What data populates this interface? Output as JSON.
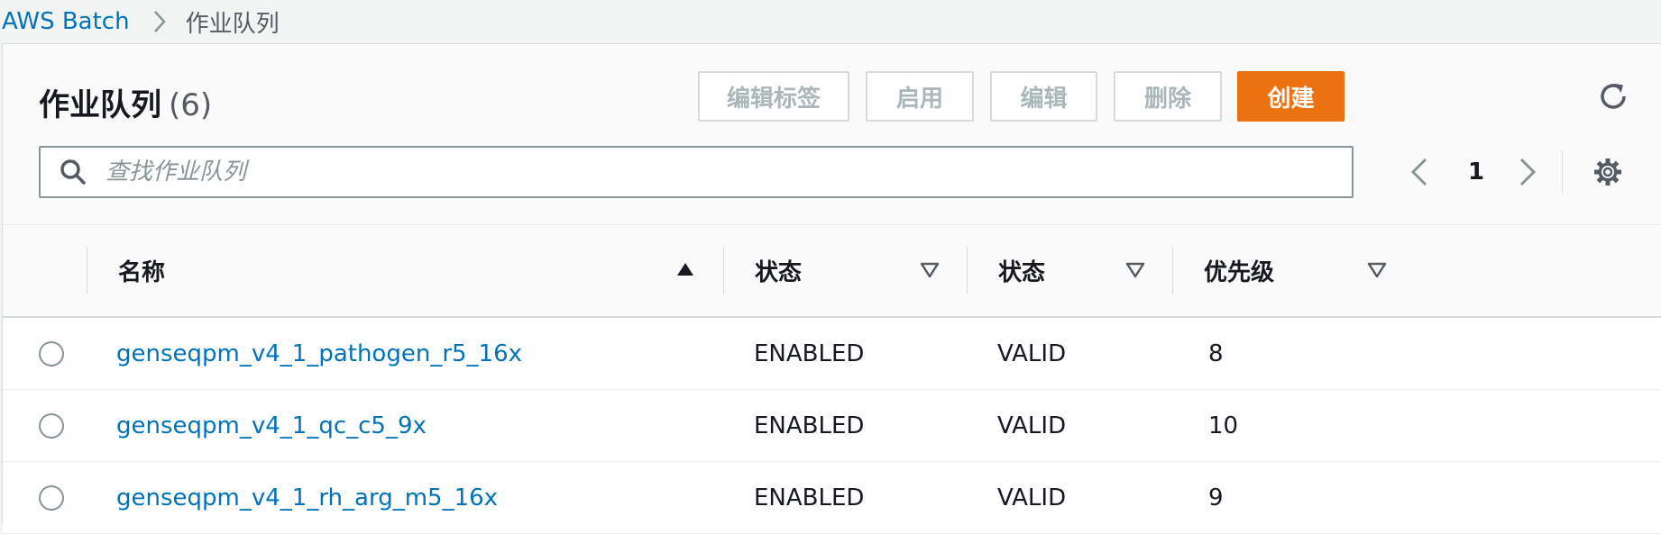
{
  "breadcrumb": {
    "root": "AWS Batch",
    "current": "作业队列"
  },
  "header": {
    "title": "作业队列",
    "count": "(6)"
  },
  "toolbar": {
    "edit_tags": "编辑标签",
    "enable": "启用",
    "edit": "编辑",
    "delete": "删除",
    "create": "创建"
  },
  "search": {
    "placeholder": "查找作业队列",
    "value": ""
  },
  "pagination": {
    "current_page": "1"
  },
  "table": {
    "columns": [
      "名称",
      "状态",
      "状态",
      "优先级"
    ],
    "rows": [
      {
        "name": "genseqpm_v4_1_pathogen_r5_16x",
        "state": "ENABLED",
        "status": "VALID",
        "priority": "8"
      },
      {
        "name": "genseqpm_v4_1_qc_c5_9x",
        "state": "ENABLED",
        "status": "VALID",
        "priority": "10"
      },
      {
        "name": "genseqpm_v4_1_rh_arg_m5_16x",
        "state": "ENABLED",
        "status": "VALID",
        "priority": "9"
      }
    ]
  },
  "colors": {
    "accent": "#ec7211",
    "link": "#0073bb",
    "text": "#16191f",
    "muted": "#879596"
  }
}
